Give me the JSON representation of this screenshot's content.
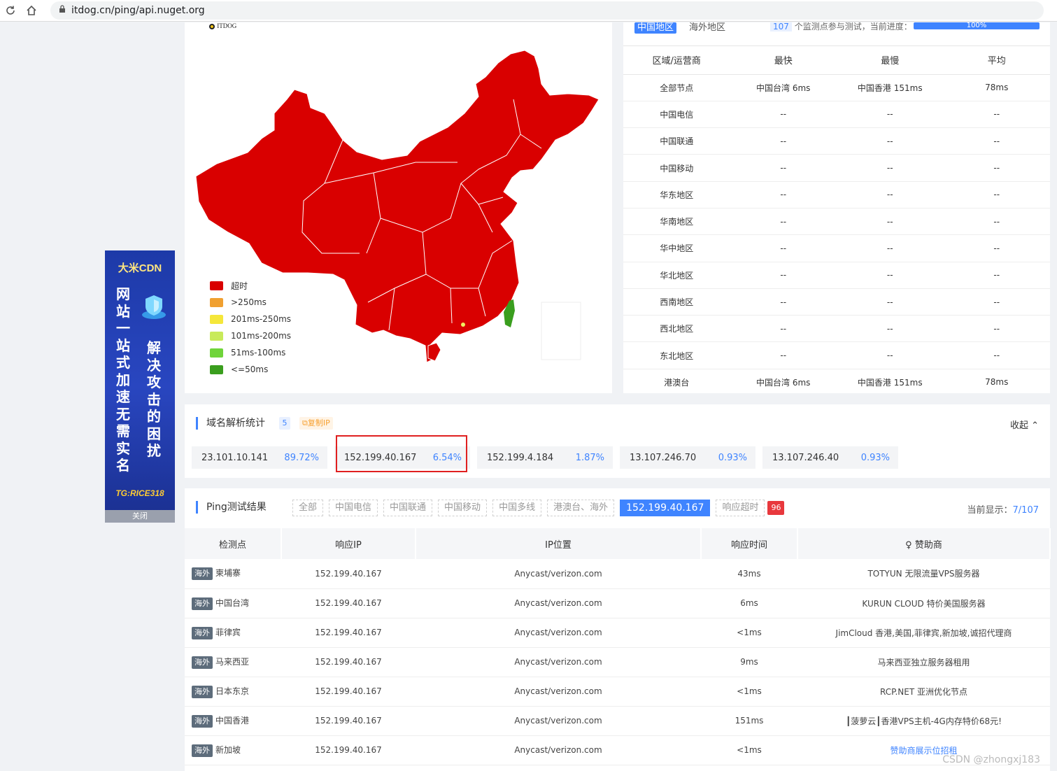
{
  "browser": {
    "url": "itdog.cn/ping/api.nuget.org"
  },
  "ad": {
    "brand": "大米CDN",
    "col1": [
      "网",
      "站",
      "一",
      "站",
      "式",
      "加",
      "速",
      "无",
      "需",
      "实",
      "名"
    ],
    "col2": [
      "解",
      "决",
      "攻",
      "击",
      "的",
      "困",
      "扰"
    ],
    "tg": "TG:RICE318",
    "close": "关闭"
  },
  "map": {
    "logo": "ITDOG",
    "legend": [
      {
        "label": "超时",
        "color": "#d90000"
      },
      {
        "label": ">250ms",
        "color": "#f0a030"
      },
      {
        "label": "201ms-250ms",
        "color": "#f5e73a"
      },
      {
        "label": "101ms-200ms",
        "color": "#c8ea5a"
      },
      {
        "label": "51ms-100ms",
        "color": "#6fd43a"
      },
      {
        "label": "<=50ms",
        "color": "#3a9e1e"
      }
    ],
    "colors": {
      "timeout": "#d90000",
      "taiwan": "#3a9e1e",
      "hongkong": "#f0f060"
    }
  },
  "stats": {
    "tab_active": "中国地区",
    "tab_other": "海外地区",
    "node_count": "107",
    "node_count_text": "个监测点参与测试，当前进度：",
    "progress": "100%",
    "headers": [
      "区域/运营商",
      "最快",
      "最慢",
      "平均"
    ],
    "rows": [
      [
        "全部节点",
        "中国台湾 6ms",
        "中国香港 151ms",
        "78ms"
      ],
      [
        "中国电信",
        "--",
        "--",
        "--"
      ],
      [
        "中国联通",
        "--",
        "--",
        "--"
      ],
      [
        "中国移动",
        "--",
        "--",
        "--"
      ],
      [
        "华东地区",
        "--",
        "--",
        "--"
      ],
      [
        "华南地区",
        "--",
        "--",
        "--"
      ],
      [
        "华中地区",
        "--",
        "--",
        "--"
      ],
      [
        "华北地区",
        "--",
        "--",
        "--"
      ],
      [
        "西南地区",
        "--",
        "--",
        "--"
      ],
      [
        "西北地区",
        "--",
        "--",
        "--"
      ],
      [
        "东北地区",
        "--",
        "--",
        "--"
      ],
      [
        "港澳台",
        "中国台湾 6ms",
        "中国香港 151ms",
        "78ms"
      ]
    ]
  },
  "dns": {
    "title": "域名解析统计",
    "count": "5",
    "copy_ip": "复制IP",
    "collapse": "收起",
    "ips": [
      {
        "ip": "23.101.10.141",
        "pct": "89.72%"
      },
      {
        "ip": "152.199.40.167",
        "pct": "6.54%"
      },
      {
        "ip": "152.199.4.184",
        "pct": "1.87%"
      },
      {
        "ip": "13.107.246.70",
        "pct": "0.93%"
      },
      {
        "ip": "13.107.246.40",
        "pct": "0.93%"
      }
    ]
  },
  "ping": {
    "title": "Ping测试结果",
    "filters": [
      "全部",
      "中国电信",
      "中国联通",
      "中国移动",
      "中国多线",
      "港澳台、海外"
    ],
    "active_filter": "152.199.40.167",
    "timeout_label": "响应超时",
    "timeout_count": "96",
    "current_label": "当前显示：",
    "current_value": "7/107",
    "headers": [
      "检测点",
      "响应IP",
      "IP位置",
      "响应时间",
      "赞助商"
    ],
    "rows": [
      {
        "tag": "海外",
        "node": "柬埔寨",
        "ip": "152.199.40.167",
        "loc": "Anycast/verizon.com",
        "time": "43ms",
        "sponsor": "TOTYUN 无限流量VPS服务器"
      },
      {
        "tag": "海外",
        "node": "中国台湾",
        "ip": "152.199.40.167",
        "loc": "Anycast/verizon.com",
        "time": "6ms",
        "sponsor": "KURUN CLOUD 特价美国服务器"
      },
      {
        "tag": "海外",
        "node": "菲律宾",
        "ip": "152.199.40.167",
        "loc": "Anycast/verizon.com",
        "time": "<1ms",
        "sponsor": "JimCloud 香港,美国,菲律宾,新加坡,诚招代理商"
      },
      {
        "tag": "海外",
        "node": "马来西亚",
        "ip": "152.199.40.167",
        "loc": "Anycast/verizon.com",
        "time": "9ms",
        "sponsor": "马来西亚独立服务器租用"
      },
      {
        "tag": "海外",
        "node": "日本东京",
        "ip": "152.199.40.167",
        "loc": "Anycast/verizon.com",
        "time": "<1ms",
        "sponsor": "RCP.NET 亚洲优化节点"
      },
      {
        "tag": "海外",
        "node": "中国香港",
        "ip": "152.199.40.167",
        "loc": "Anycast/verizon.com",
        "time": "151ms",
        "sponsor": "┃菠萝云┃香港VPS主机-4G内存特价68元!"
      },
      {
        "tag": "海外",
        "node": "新加坡",
        "ip": "152.199.40.167",
        "loc": "Anycast/verizon.com",
        "time": "<1ms",
        "sponsor": "赞助商展示位招租",
        "sponsor_link": true
      }
    ],
    "watermark": "CSDN @zhongxj183"
  }
}
